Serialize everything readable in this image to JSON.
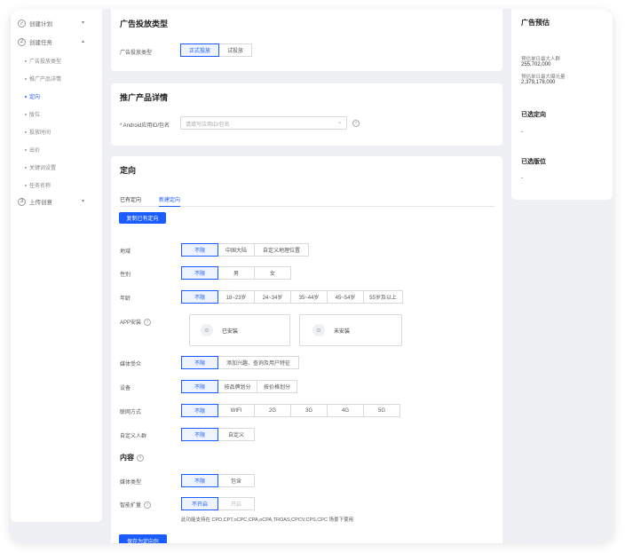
{
  "sidebar": {
    "steps": [
      {
        "num": "✓",
        "label": "创建计划",
        "chevron": "▾"
      },
      {
        "num": "2",
        "label": "创建任务",
        "chevron": "▴"
      },
      {
        "num": "3",
        "label": "上传创意",
        "chevron": "▾"
      }
    ],
    "subitems": [
      "广告投放类型",
      "推广产品详情",
      "定向",
      "版位",
      "投放时间",
      "出价",
      "关键词设置",
      "任务名称"
    ]
  },
  "ad_type": {
    "title": "广告投放类型",
    "label": "广告投放类型",
    "options": [
      "正式投放",
      "试投放"
    ]
  },
  "product": {
    "title": "推广产品详情",
    "label": "* Android应用ID/包名",
    "placeholder": "请填写应用ID/包名",
    "help": "?"
  },
  "targeting": {
    "title": "定向",
    "tabs": [
      "已有定向",
      "新建定向"
    ],
    "copy_button": "复制已有定向",
    "help": "?",
    "rows": [
      {
        "label": "地域",
        "options": [
          "不限",
          "中国大陆",
          "自定义地理位置"
        ]
      },
      {
        "label": "性别",
        "options": [
          "不限",
          "男",
          "女"
        ]
      },
      {
        "label": "年龄",
        "options": [
          "不限",
          "18~23岁",
          "24~34岁",
          "35~44岁",
          "45~54岁",
          "55岁及以上"
        ]
      }
    ],
    "app_install": {
      "label": "APP安装",
      "installed": "已安装",
      "not_installed": "未安装"
    },
    "rows2": [
      {
        "label": "媒体受众",
        "options": [
          "不限",
          "添加兴趣、查询及用户特征"
        ]
      },
      {
        "label": "设备",
        "options": [
          "不限",
          "按品牌划分",
          "按价格划分"
        ]
      },
      {
        "label": "联网方式",
        "options": [
          "不限",
          "WIFI",
          "2G",
          "3G",
          "4G",
          "5G"
        ]
      },
      {
        "label": "自定义人群",
        "options": [
          "不限",
          "自定义"
        ]
      }
    ],
    "content_title": "内容",
    "rows3": [
      {
        "label": "媒体类型",
        "options": [
          "不限",
          "包含"
        ]
      },
      {
        "label": "智能扩量",
        "options": [
          "不开启",
          "开启"
        ]
      }
    ],
    "smart_note": "此功能支持在 CPD,CPT,oCPC,CPA,oCPA,TROAS,CPCV,CPS,CPC 场景下使用",
    "save_button": "保存为定向包"
  },
  "forecast": {
    "title": "广告预估",
    "reach_label": "预估单日最大人群",
    "reach_value": "255,702,000",
    "exposure_label": "预估单日最大曝光量",
    "exposure_value": "2,379,178,000",
    "selected_targeting_title": "已选定向",
    "selected_targeting_value": "-",
    "selected_slot_title": "已选版位",
    "selected_slot_value": "-"
  },
  "colors": {
    "accent": "#1a5cff",
    "background": "#eef0f4"
  }
}
